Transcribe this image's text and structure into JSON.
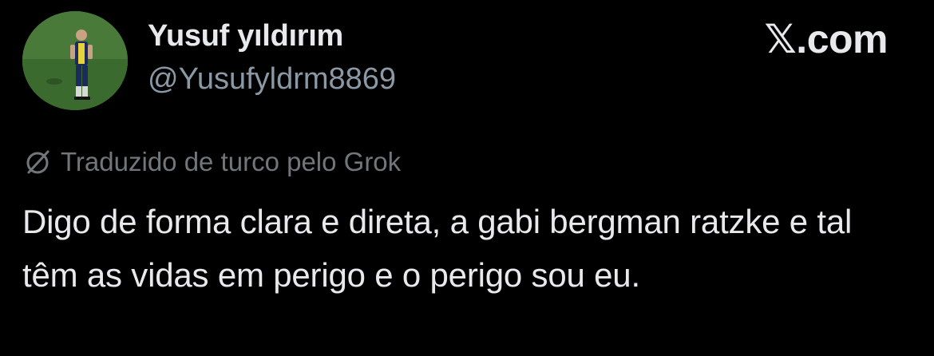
{
  "author": {
    "display_name": "Yusuf yıldırım",
    "handle": "@Yusufyldrm8869",
    "avatar_icon": "avatar-photo"
  },
  "brand": {
    "label": "𝕏.com"
  },
  "translation": {
    "icon": "grok-icon",
    "label": "Traduzido de turco pelo Grok"
  },
  "tweet": {
    "text": "Digo de forma clara e direta, a gabi bergman ratzke e tal têm as vidas em perigo e o perigo sou eu."
  },
  "colors": {
    "background": "#000000",
    "primary_text": "#e7e9ea",
    "secondary_text": "#8b98a5",
    "muted_text": "#71767b"
  }
}
